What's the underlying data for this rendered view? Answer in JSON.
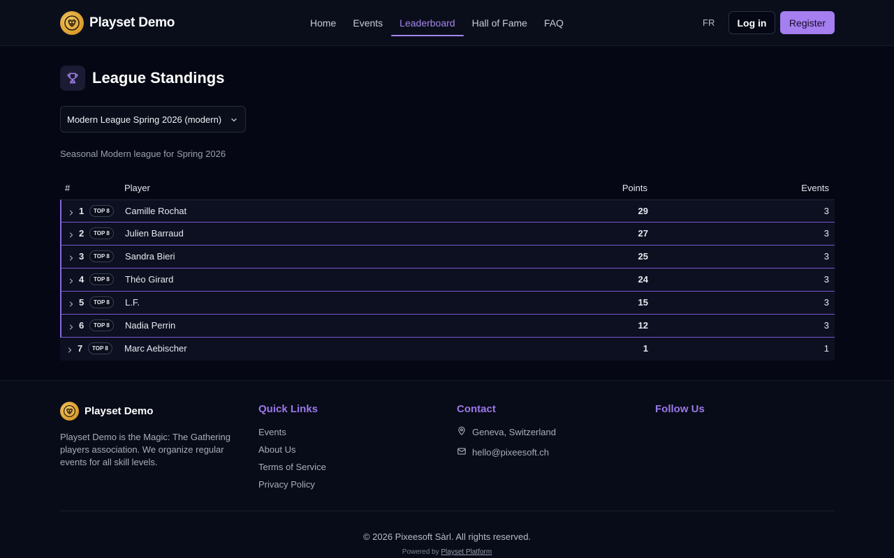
{
  "brand": {
    "name": "Playset Demo"
  },
  "nav": [
    {
      "label": "Home"
    },
    {
      "label": "Events"
    },
    {
      "label": "Leaderboard"
    },
    {
      "label": "Hall of Fame"
    },
    {
      "label": "FAQ"
    }
  ],
  "header": {
    "lang": "FR",
    "login": "Log in",
    "register": "Register"
  },
  "page": {
    "title": "League Standings",
    "league_select": "Modern League Spring 2026 (modern)",
    "subtitle": "Seasonal Modern league for Spring 2026"
  },
  "table": {
    "headers": {
      "rank": "#",
      "player": "Player",
      "points": "Points",
      "events": "Events"
    },
    "rows": [
      {
        "rank": "1",
        "badge": "TOP 8",
        "player": "Camille Rochat",
        "points": "29",
        "events": "3"
      },
      {
        "rank": "2",
        "badge": "TOP 8",
        "player": "Julien Barraud",
        "points": "27",
        "events": "3"
      },
      {
        "rank": "3",
        "badge": "TOP 8",
        "player": "Sandra Bieri",
        "points": "25",
        "events": "3"
      },
      {
        "rank": "4",
        "badge": "TOP 8",
        "player": "Théo Girard",
        "points": "24",
        "events": "3"
      },
      {
        "rank": "5",
        "badge": "TOP 8",
        "player": "L.F.",
        "points": "15",
        "events": "3"
      },
      {
        "rank": "6",
        "badge": "TOP 8",
        "player": "Nadia Perrin",
        "points": "12",
        "events": "3"
      },
      {
        "rank": "7",
        "badge": "TOP 8",
        "player": "Marc Aebischer",
        "points": "1",
        "events": "1"
      }
    ]
  },
  "footer": {
    "brand": "Playset Demo",
    "description": "Playset Demo is the Magic: The Gathering players association. We organize regular events for all skill levels.",
    "quick_links_title": "Quick Links",
    "quick_links": [
      "Events",
      "About Us",
      "Terms of Service",
      "Privacy Policy"
    ],
    "contact_title": "Contact",
    "location": "Geneva, Switzerland",
    "email": "hello@pixeesoft.ch",
    "follow_title": "Follow Us",
    "copyright": "© 2026 Pixeesoft Sàrl. All rights reserved.",
    "powered_prefix": "Powered by",
    "powered_link": "Playset Platform"
  },
  "colors": {
    "accent": "#a57ef0",
    "background": "#050814"
  },
  "icons": {
    "logo": "tiger-logo-icon",
    "title": "trophy-icon",
    "expand": "chevron-right-icon",
    "location": "map-pin-icon",
    "email": "mail-icon"
  }
}
